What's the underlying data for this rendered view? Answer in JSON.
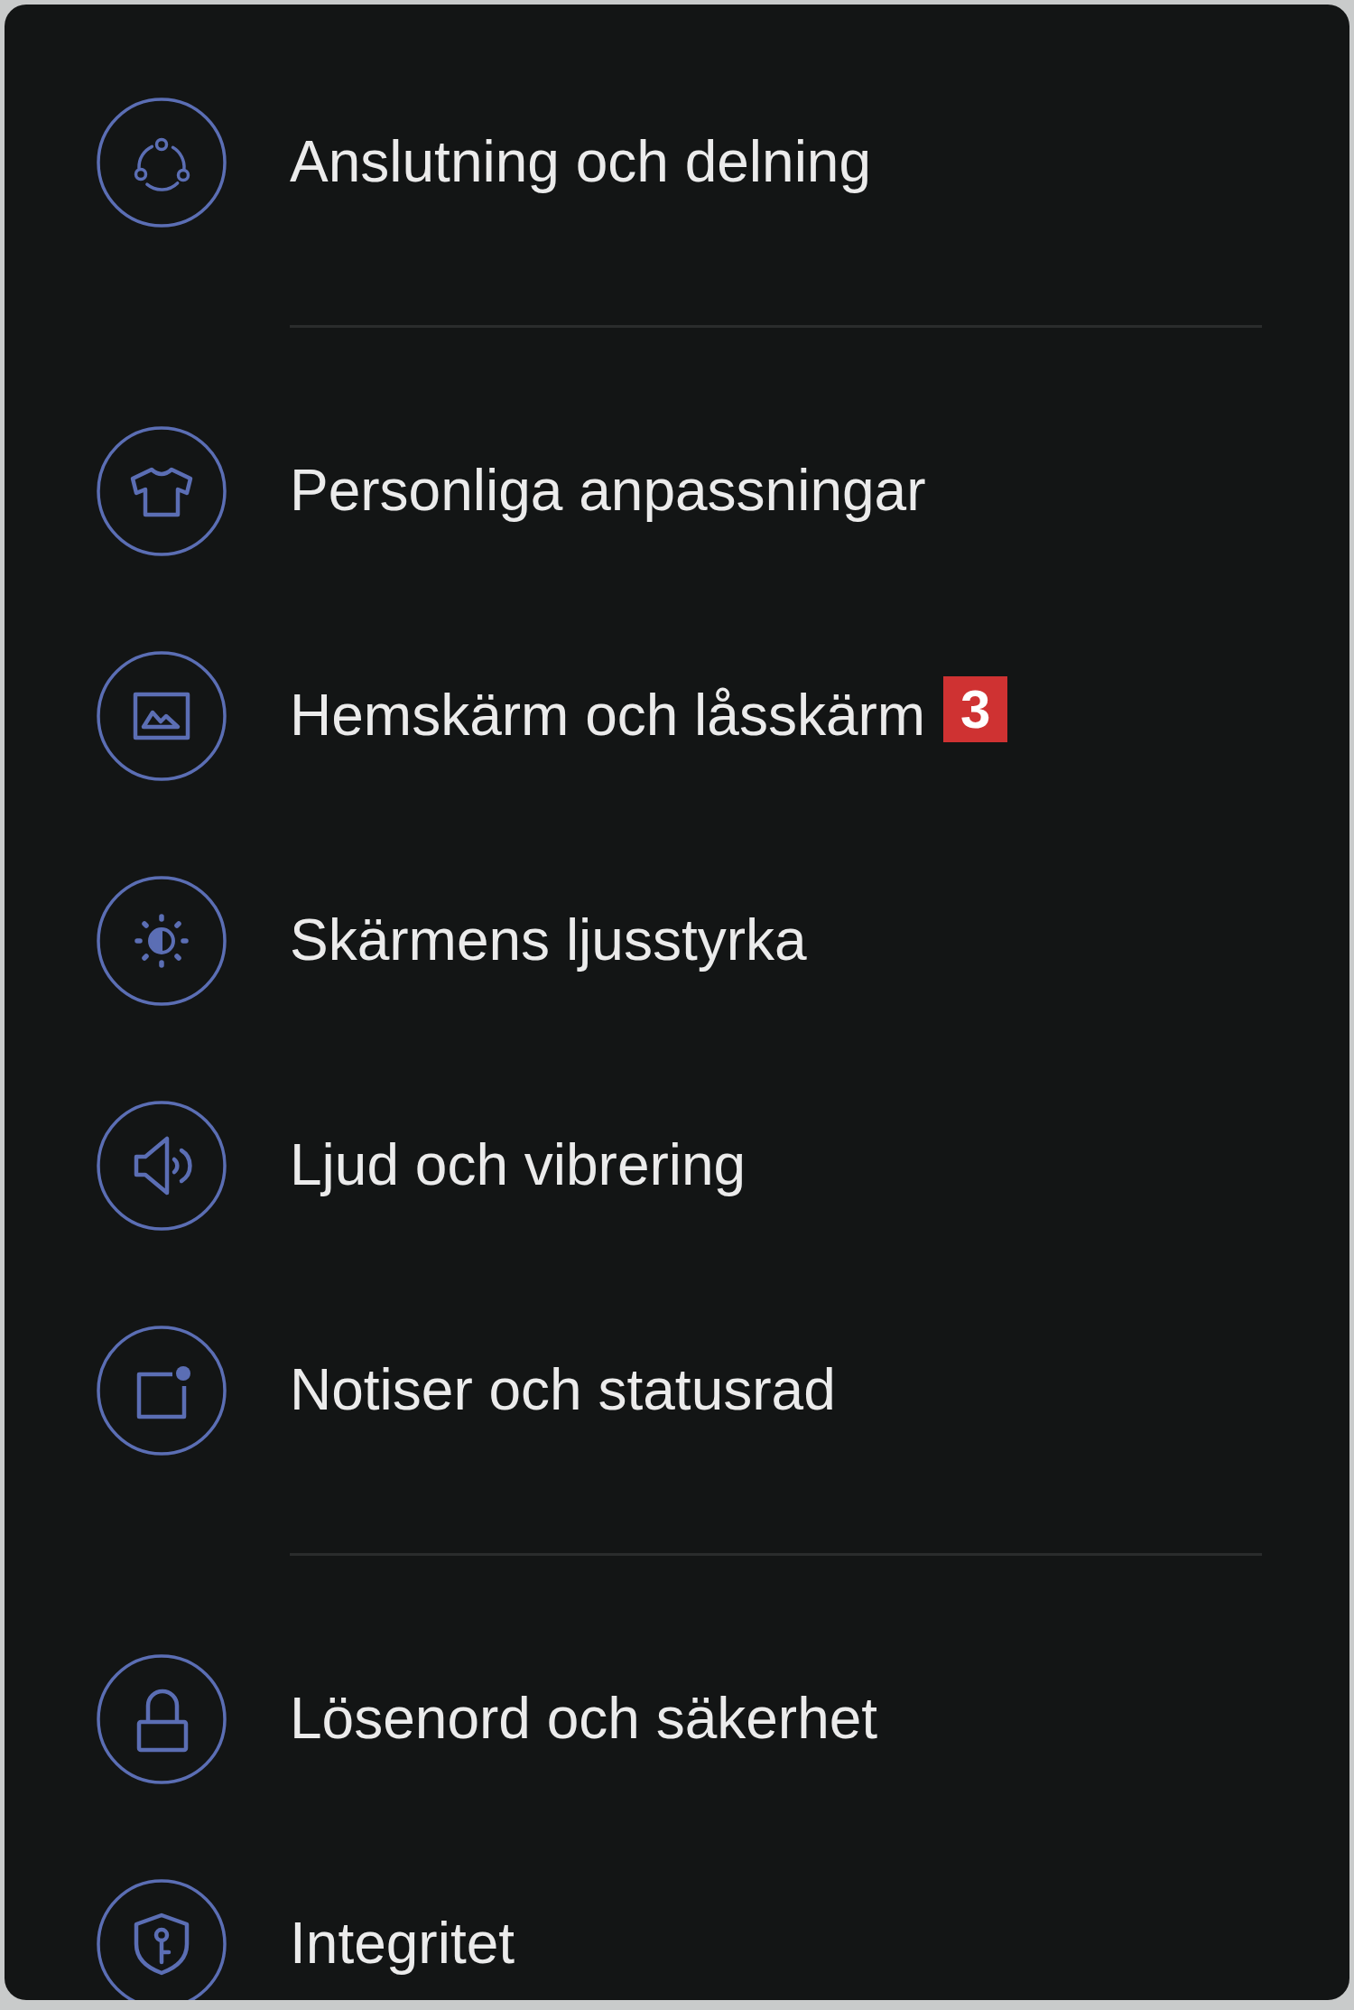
{
  "settings_groups": [
    {
      "items": [
        {
          "label": "Anslutning och delning"
        }
      ]
    },
    {
      "items": [
        {
          "label": "Personliga anpassningar"
        },
        {
          "label": "Hemskärm och låsskärm",
          "badge": "3"
        },
        {
          "label": "Skärmens ljusstyrka"
        },
        {
          "label": "Ljud och vibrering"
        },
        {
          "label": "Notiser och statusrad"
        }
      ]
    },
    {
      "items": [
        {
          "label": "Lösenord och säkerhet"
        },
        {
          "label": "Integritet"
        }
      ]
    }
  ]
}
